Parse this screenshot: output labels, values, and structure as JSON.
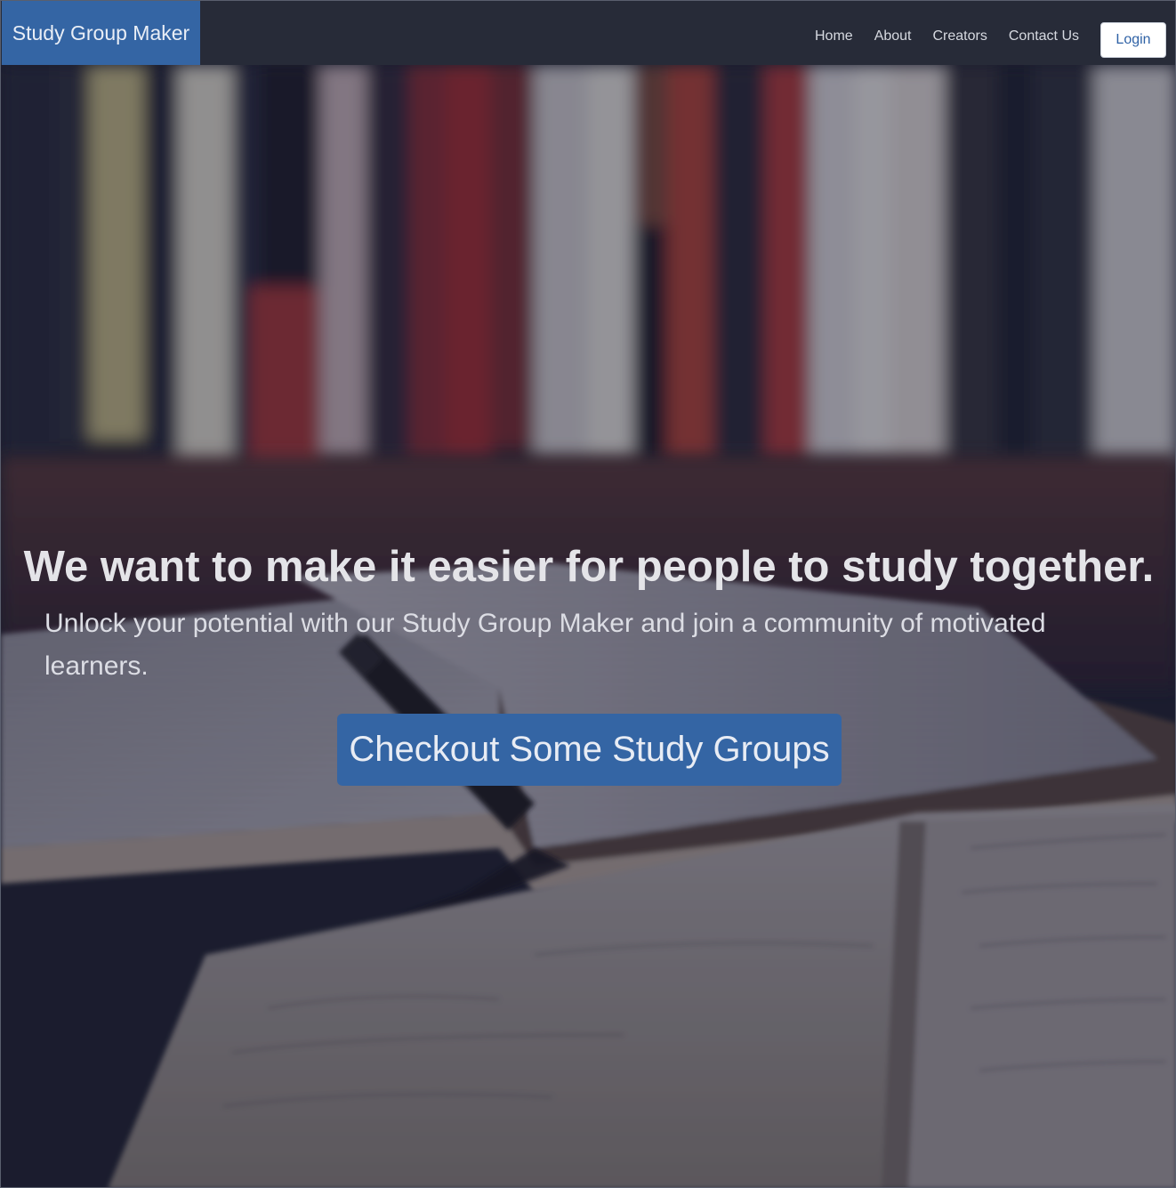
{
  "navbar": {
    "brand": "Study Group Maker",
    "links": [
      "Home",
      "About",
      "Creators",
      "Contact Us"
    ],
    "login_label": "Login"
  },
  "hero": {
    "background_image": "blurred bookshelf with open books and a pen in the foreground",
    "title": "We want to make it easier for people to study together.",
    "subtitle": "Unlock your potential with our Study Group Maker and join a community of motivated learners.",
    "cta_label": "Checkout Some Study Groups"
  },
  "colors": {
    "navbar_bg": "#272b38",
    "brand_bg": "#3465a4",
    "cta_bg": "#3465a4",
    "login_text": "#2f62a6"
  }
}
